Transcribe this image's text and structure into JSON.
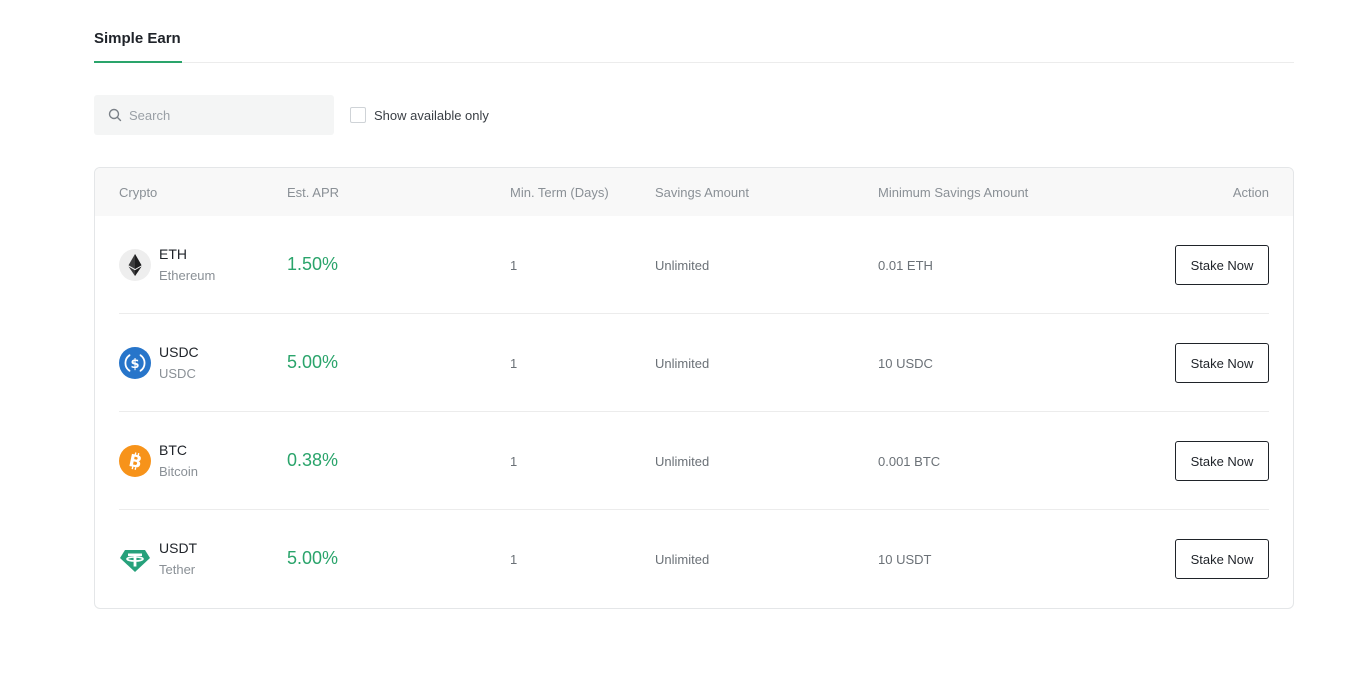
{
  "tabs": [
    {
      "label": "Simple Earn"
    }
  ],
  "search": {
    "placeholder": "Search",
    "value": "",
    "icon": "search-icon"
  },
  "filter": {
    "label": "Show available only",
    "checked": false
  },
  "table": {
    "headers": {
      "crypto": "Crypto",
      "apr": "Est. APR",
      "term": "Min. Term (Days)",
      "savings": "Savings Amount",
      "minimum": "Minimum Savings Amount",
      "action": "Action"
    },
    "rows": [
      {
        "symbol": "ETH",
        "name": "Ethereum",
        "apr": "1.50%",
        "term": "1",
        "savings": "Unlimited",
        "minimum": "0.01 ETH",
        "action": "Stake Now",
        "icon": "ethereum-icon"
      },
      {
        "symbol": "USDC",
        "name": "USDC",
        "apr": "5.00%",
        "term": "1",
        "savings": "Unlimited",
        "minimum": "10 USDC",
        "action": "Stake Now",
        "icon": "usdc-icon"
      },
      {
        "symbol": "BTC",
        "name": "Bitcoin",
        "apr": "0.38%",
        "term": "1",
        "savings": "Unlimited",
        "minimum": "0.001 BTC",
        "action": "Stake Now",
        "icon": "bitcoin-icon"
      },
      {
        "symbol": "USDT",
        "name": "Tether",
        "apr": "5.00%",
        "term": "1",
        "savings": "Unlimited",
        "minimum": "10 USDT",
        "action": "Stake Now",
        "icon": "tether-icon"
      }
    ]
  },
  "colors": {
    "accent": "#2aa46b",
    "eth": "#3c3c3d",
    "usdc": "#2775ca",
    "btc": "#f7931a",
    "usdt": "#26a17b"
  }
}
